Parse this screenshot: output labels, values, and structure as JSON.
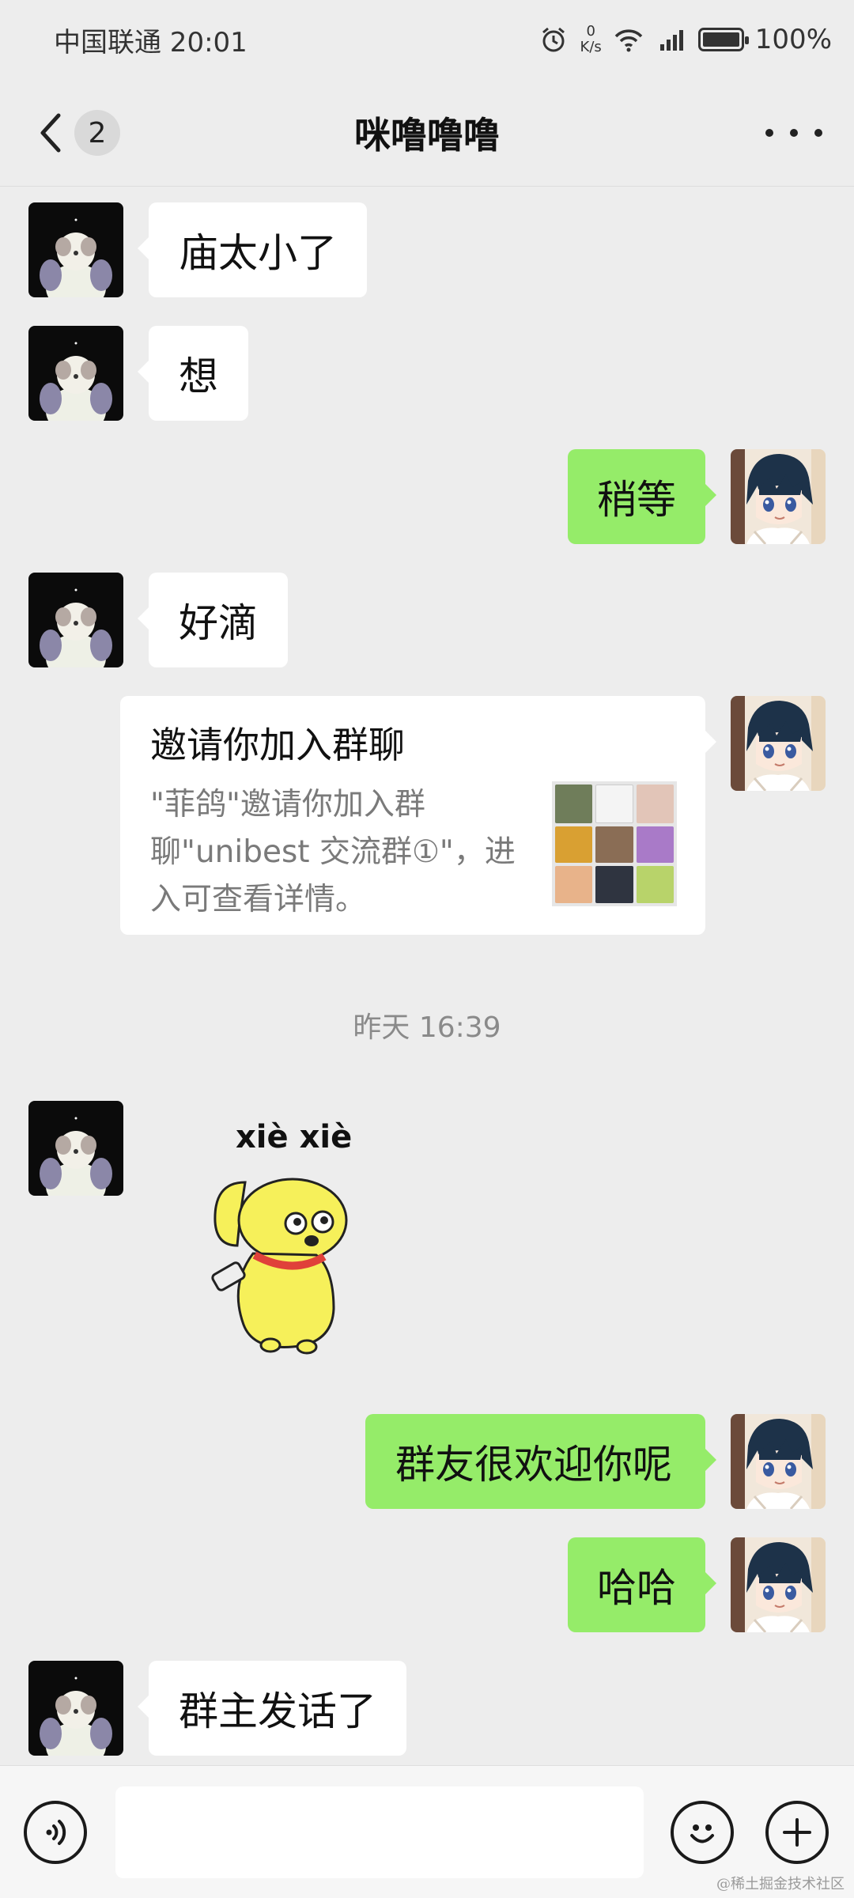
{
  "status_bar": {
    "carrier_time": "中国联通 20:01",
    "net_speed_value": "0",
    "net_speed_unit": "K/s",
    "battery": "100%"
  },
  "header": {
    "back_badge": "2",
    "title": "咪噜噜噜"
  },
  "messages": [
    {
      "side": "left",
      "text": "庙太小了"
    },
    {
      "side": "left",
      "text": "想"
    },
    {
      "side": "right",
      "text": "稍等"
    },
    {
      "side": "left",
      "text": "好滴"
    },
    {
      "side": "right",
      "type": "card"
    },
    {
      "side": "left",
      "type": "sticker"
    },
    {
      "side": "right",
      "text": "群友很欢迎你呢"
    },
    {
      "side": "right",
      "text": "哈哈"
    },
    {
      "side": "left",
      "text": "群主发话了"
    }
  ],
  "invite_card": {
    "title": "邀请你加入群聊",
    "description": "\"菲鸽\"邀请你加入群聊\"unibest 交流群①\"，进入可查看详情。"
  },
  "timestamp": "昨天 16:39",
  "sticker": {
    "caption": "xiè xiè",
    "icon": "yellow-dog-sticker"
  },
  "colors": {
    "background": "#ededed",
    "outgoing_bubble": "#95ec69",
    "incoming_bubble": "#ffffff"
  },
  "watermark": "@稀土掘金技术社区"
}
